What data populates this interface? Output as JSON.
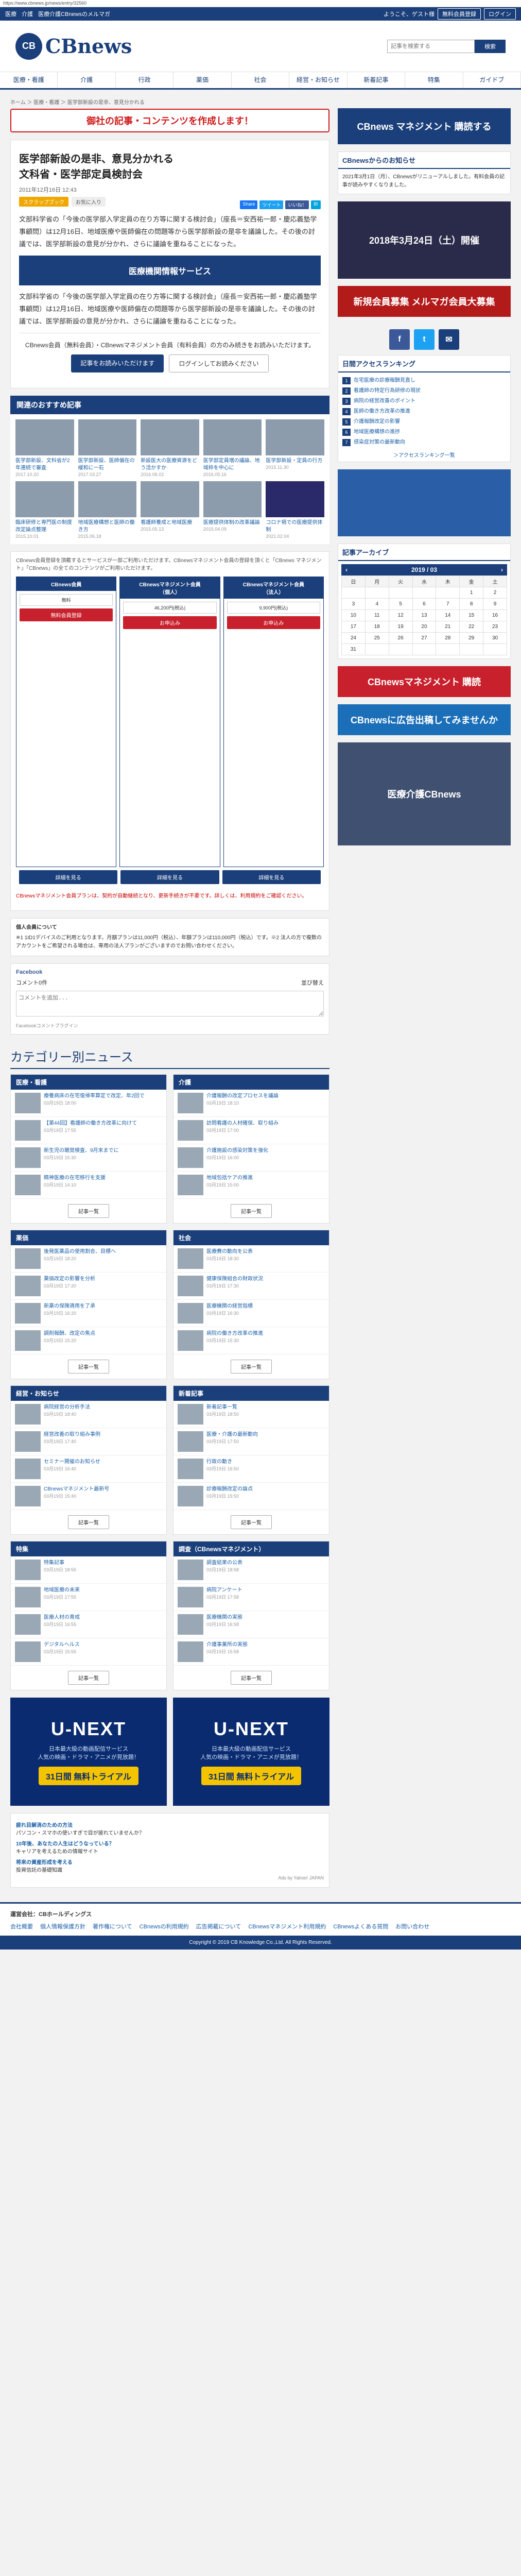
{
  "browser": {
    "url": "https://www.cbnews.jp/news/entry/32560"
  },
  "topbar": {
    "left": [
      "医療",
      "介護",
      "医療介護CBnewsのメルマガ"
    ],
    "welcome": "ようこそ、ゲスト様",
    "signup": "無料会員登録",
    "login": "ログイン"
  },
  "header": {
    "logo": "CBnews",
    "search_placeholder": "記事を検索する",
    "search_button": "検索"
  },
  "nav": [
    "医療・看護",
    "介護",
    "行政",
    "薬価",
    "社会",
    "経営・お知らせ",
    "新着記事",
    "特集",
    "ガイドブ"
  ],
  "breadcrumb": "ホーム ＞ 医療・看護 ＞ 医学部新設の是非、意見分かれる",
  "red_banner": "御社の記事・コンテンツを作成します！",
  "article": {
    "title": "医学部新設の是非、意見分かれる\n文科省・医学部定員検討会",
    "date": "2011年12月16日 12:43",
    "tag1": "スクラップブック",
    "tag2": "お気に入り",
    "share": [
      "Share",
      "ツイート",
      "いいね！",
      "B!"
    ],
    "p1": "文部科学省の「今後の医学部入学定員の在り方等に関する検討会」（座長＝安西祐一郎・慶応義塾学事顧問）は12月16日、地域医療や医師偏在の問題等から医学部新設の是非を議論した。その後の討議では、医学部新設の意見が分かれ、さらに議論を重ねることになった。",
    "ad_banner": "医療機関情報サービス",
    "p2": "文部科学省の「今後の医学部入学定員の在り方等に関する検討会」（座長＝安西祐一郎・慶応義塾学事顧問）は12月16日、地域医療や医師偏在の問題等から医学部新設の是非を議論した。その後の討議では、医学部新設の意見が分かれ、さらに議論を重ねることになった。",
    "login_note": "CBnews会員（無料会員）・CBnewsマネジメント会員（有料会員）の方のみ続きをお読みいただけます。",
    "login_btn": "記事をお読みいただけます",
    "signup_btn": "ログインしてお読みください"
  },
  "recommend": {
    "title": "関連のおすすめ記事",
    "items": [
      {
        "t": "医学部新設、文科省が2年連続で審査",
        "d": "2017.10.20"
      },
      {
        "t": "医学部新設、医師偏在の緩和に一石",
        "d": "2017.03.27"
      },
      {
        "t": "新設医大の医療資源をどう活かすか",
        "d": "2016.06.02"
      },
      {
        "t": "医学部定員増の議論、地域枠を中心に",
        "d": "2016.05.16"
      },
      {
        "t": "医学部新設・定員の行方",
        "d": "2015.11.30"
      },
      {
        "t": "臨床研修と専門医の制度改定論点整理",
        "d": "2015.10.01"
      },
      {
        "t": "地域医療構想と医師の働き方",
        "d": "2015.06.18"
      },
      {
        "t": "看護師養成と地域医療",
        "d": "2015.05.13"
      },
      {
        "t": "医療提供体制の改革議論",
        "d": "2015.04.09"
      },
      {
        "t": "コロナ禍での医療提供体制",
        "d": "2021.02.04"
      }
    ]
  },
  "plans": {
    "note": "CBnews会員登録を頂戴するとサービスが一部ご利用いただけます。CBnewsマネジメント会員の登録を頂くと「CBnews マネジメント」「CBnews」の全てのコンテンツがご利用いただけます。",
    "cols": [
      {
        "head": "CBnews会員",
        "price": "無料",
        "btn": "無料会員登録"
      },
      {
        "head": "CBnewsマネジメント会員\n（個人）",
        "price": "46,200円(税込)",
        "btn": "お申込み"
      },
      {
        "head": "CBnewsマネジメント会員\n（法人）",
        "price": "9,900円(税込)",
        "btn": "お申込み"
      }
    ],
    "row_btns": [
      "詳細を見る",
      "詳細を見る",
      "詳細を見る"
    ]
  },
  "warn": "CBnewsマネジメント会員プランは、契約が自動継続となり、更新手続きが不要です。詳しくは、利用規約をご確認ください。",
  "personal": {
    "h": "個人会員について",
    "t": "※1 1ID1デバイスのご利用となります。月額プランは11,000円（税込）、年額プランは110,000円（税込）です。※2 法人の方で複数のアカウントをご希望される場合は、専用の法人プランがございますのでお問い合わせください。"
  },
  "comment": {
    "fb": "Facebook",
    "count": "コメント0件",
    "sort": "並び替え",
    "placeholder": "コメントを追加...",
    "plugin": "Facebookコメントプラグイン"
  },
  "categories": {
    "head": "カテゴリー別ニュース",
    "blocks": [
      {
        "name": "医療・看護",
        "items": [
          {
            "t": "療養病床の在宅復帰率算定で改定、年2回で",
            "d": "03月19日 18:00"
          },
          {
            "t": "【第44回】看護師の働き方改革に向けて",
            "d": "03月19日 17:55"
          },
          {
            "t": "新生児の聴覚検査、9月末までに",
            "d": "03月19日 15:30"
          },
          {
            "t": "精神医療の在宅移行を支援",
            "d": "03月19日 14:10"
          }
        ]
      },
      {
        "name": "介護",
        "items": [
          {
            "t": "介護報酬の改定プロセスを議論",
            "d": "03月19日 18:10"
          },
          {
            "t": "訪問看護の人材確保、取り組み",
            "d": "03月19日 17:00"
          },
          {
            "t": "介護施設の感染対策を強化",
            "d": "03月19日 16:00"
          },
          {
            "t": "地域包括ケアの推進",
            "d": "03月19日 15:00"
          }
        ]
      },
      {
        "name": "薬価",
        "items": [
          {
            "t": "後発医薬品の使用割合、目標へ",
            "d": "03月19日 18:20"
          },
          {
            "t": "薬価改定の影響を分析",
            "d": "03月19日 17:20"
          },
          {
            "t": "新薬の保険適用を了承",
            "d": "03月19日 16:20"
          },
          {
            "t": "調剤報酬、改定の焦点",
            "d": "03月19日 15:20"
          }
        ]
      },
      {
        "name": "社会",
        "items": [
          {
            "t": "医療費の動向を公表",
            "d": "03月19日 18:30"
          },
          {
            "t": "健康保険組合の財政状況",
            "d": "03月19日 17:30"
          },
          {
            "t": "医療機関の経営指標",
            "d": "03月19日 16:30"
          },
          {
            "t": "病院の働き方改革の推進",
            "d": "03月19日 15:30"
          }
        ]
      },
      {
        "name": "経営・お知らせ",
        "items": [
          {
            "t": "病院経営の分析手法",
            "d": "03月19日 18:40"
          },
          {
            "t": "経営改善の取り組み事例",
            "d": "03月19日 17:40"
          },
          {
            "t": "セミナー開催のお知らせ",
            "d": "03月19日 16:40"
          },
          {
            "t": "CBnewsマネジメント最新号",
            "d": "03月19日 15:40"
          }
        ]
      },
      {
        "name": "新着記事",
        "items": [
          {
            "t": "新着記事一覧",
            "d": "03月19日 18:50"
          },
          {
            "t": "医療・介護の最新動向",
            "d": "03月19日 17:50"
          },
          {
            "t": "行政の動き",
            "d": "03月19日 16:50"
          },
          {
            "t": "診療報酬改定の論点",
            "d": "03月19日 15:50"
          }
        ]
      },
      {
        "name": "特集",
        "items": [
          {
            "t": "特集記事",
            "d": "03月19日 18:55"
          },
          {
            "t": "地域医療の未来",
            "d": "03月19日 17:55"
          },
          {
            "t": "医療人材の育成",
            "d": "03月19日 16:55"
          },
          {
            "t": "デジタルヘルス",
            "d": "03月19日 15:55"
          }
        ]
      },
      {
        "name": "調査（CBnewsマネジメント）",
        "items": [
          {
            "t": "調査結果の公表",
            "d": "03月19日 18:58"
          },
          {
            "t": "病院アンケート",
            "d": "03月19日 17:58"
          },
          {
            "t": "医療機関の実態",
            "d": "03月19日 16:58"
          },
          {
            "t": "介護事業所の実態",
            "d": "03月19日 15:58"
          }
        ]
      }
    ],
    "more": "記事一覧"
  },
  "unext": {
    "logo": "U-NEXT",
    "sub": "日本最大級の動画配信サービス\n人気の映画・ドラマ・アニメが見放題！",
    "deal": "31日間 無料トライアル"
  },
  "adlinks": {
    "items": [
      {
        "h": "疲れ目解消のための方法",
        "t": "パソコン・スマホの使いすぎで目が疲れていませんか？"
      },
      {
        "h": "10年後、あなたの人生はどうなっている？",
        "t": "キャリアを考えるための情報サイト"
      },
      {
        "h": "将来の資産形成を考える",
        "t": "投資信託の基礎知識"
      }
    ],
    "adby": "Ads by Yahoo! JAPAN"
  },
  "side": {
    "top_ad": "CBnews マネジメント 購読する",
    "msg_title": "CBnewsからのお知らせ",
    "msg": "2021年3月1日（月）、CBnewsがリニューアルしました。有料会員の記事が読みやすくなりました。",
    "ad2": "2018年3月24日（土）開催",
    "ad3": "新規会員募集 メルマガ会員大募集",
    "socials": [
      "f",
      "t",
      "✉"
    ],
    "rank_title": "日間アクセスランキング",
    "rank": [
      "在宅医療の診療報酬見直し",
      "看護師の特定行為研修の現状",
      "病院の経営改善のポイント",
      "医師の働き方改革の推進",
      "介護報酬改定の影響",
      "地域医療構想の進捗",
      "感染症対策の最新動向"
    ],
    "rank_more": "＞アクセスランキング一覧",
    "archive_title": "記事アーカイブ",
    "month": "2019 / 03",
    "week": [
      "日",
      "月",
      "火",
      "水",
      "木",
      "金",
      "土"
    ],
    "days": [
      [
        "",
        "",
        "",
        "",
        "",
        "1",
        "2"
      ],
      [
        "3",
        "4",
        "5",
        "6",
        "7",
        "8",
        "9"
      ],
      [
        "10",
        "11",
        "12",
        "13",
        "14",
        "15",
        "16"
      ],
      [
        "17",
        "18",
        "19",
        "20",
        "21",
        "22",
        "23"
      ],
      [
        "24",
        "25",
        "26",
        "27",
        "28",
        "29",
        "30"
      ],
      [
        "31",
        "",
        "",
        "",
        "",
        "",
        ""
      ]
    ],
    "ad4": "CBnewsマネジメント 購読",
    "ad5": "CBnewsに広告出稿してみませんか",
    "ad6": "医療介護CBnews"
  },
  "footer": {
    "company": "運営会社：CBホールディングス",
    "links": [
      "会社概要",
      "個人情報保護方針",
      "著作権について",
      "CBnewsの利用規約",
      "広告掲載について",
      "CBnewsマネジメント利用規約",
      "CBnewsよくある質問",
      "お問い合わせ"
    ],
    "copy": "Copyright © 2019 CB Knowledge Co.,Ltd. All Rights Reserved."
  }
}
